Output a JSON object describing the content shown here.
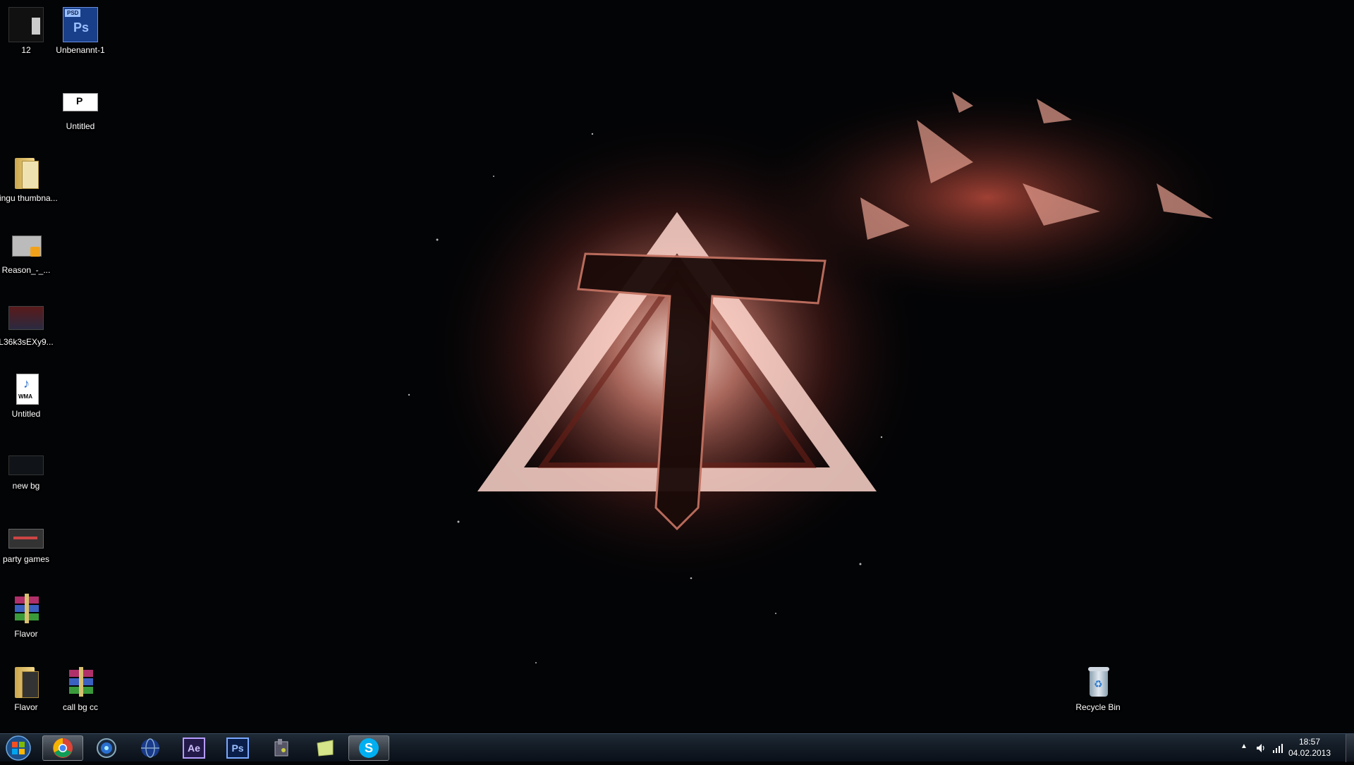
{
  "desktop": {
    "icons": [
      {
        "id": "12",
        "label": "12"
      },
      {
        "id": "unbenannt",
        "label": "Unbenannt-1"
      },
      {
        "id": "untitled-p",
        "label": "Untitled"
      },
      {
        "id": "pingu",
        "label": "pingu thumbna..."
      },
      {
        "id": "reason",
        "label": "Reason_-_..."
      },
      {
        "id": "l36k",
        "label": "L36k3sEXy9..."
      },
      {
        "id": "untitled-wma",
        "label": "Untitled"
      },
      {
        "id": "newbg",
        "label": "new bg"
      },
      {
        "id": "partygames",
        "label": "party games"
      },
      {
        "id": "flavor-rar",
        "label": "Flavor"
      },
      {
        "id": "flavor-folder",
        "label": "Flavor"
      },
      {
        "id": "callbg",
        "label": "call bg cc"
      },
      {
        "id": "recycle",
        "label": "Recycle Bin"
      }
    ],
    "badges": {
      "psd": "PSD",
      "ps": "Ps",
      "p": "P",
      "wma": "WMA"
    }
  },
  "taskbar": {
    "apps": [
      {
        "name": "chrome",
        "active": true
      },
      {
        "name": "media-player"
      },
      {
        "name": "globe"
      },
      {
        "name": "after-effects",
        "text": "Ae"
      },
      {
        "name": "photoshop",
        "text": "Ps"
      },
      {
        "name": "game"
      },
      {
        "name": "sticky-notes"
      },
      {
        "name": "skype",
        "text": "S",
        "active": true
      }
    ],
    "clock": {
      "time": "18:57",
      "date": "04.02.2013"
    }
  },
  "colors": {
    "accent": "#d87a6a",
    "ps_blue": "#0a1e4a",
    "ae_purple": "#231a4a",
    "skype": "#00aff0"
  }
}
